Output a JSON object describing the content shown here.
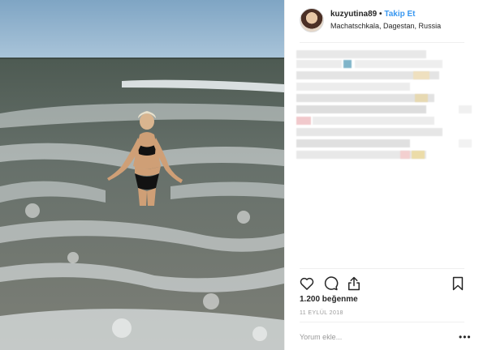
{
  "post": {
    "username": "kuzyutina89",
    "separator": "•",
    "follow_label": "Takip Et",
    "location": "Machatschkala, Dagestan, Russia",
    "likes_text": "1.200 beğenme",
    "date_text": "11 EYLÜL 2018",
    "comment_placeholder": "Yorum ekle...",
    "more_label": "•••"
  },
  "icons": {
    "like": "heart-icon",
    "comment": "comment-icon",
    "share": "share-icon",
    "save": "bookmark-icon",
    "options": "more-options-icon"
  },
  "colors": {
    "accent": "#3897f0",
    "sky": "#8fb2cc",
    "sea": "#5e6b5f",
    "foam": "#e9eef0"
  }
}
